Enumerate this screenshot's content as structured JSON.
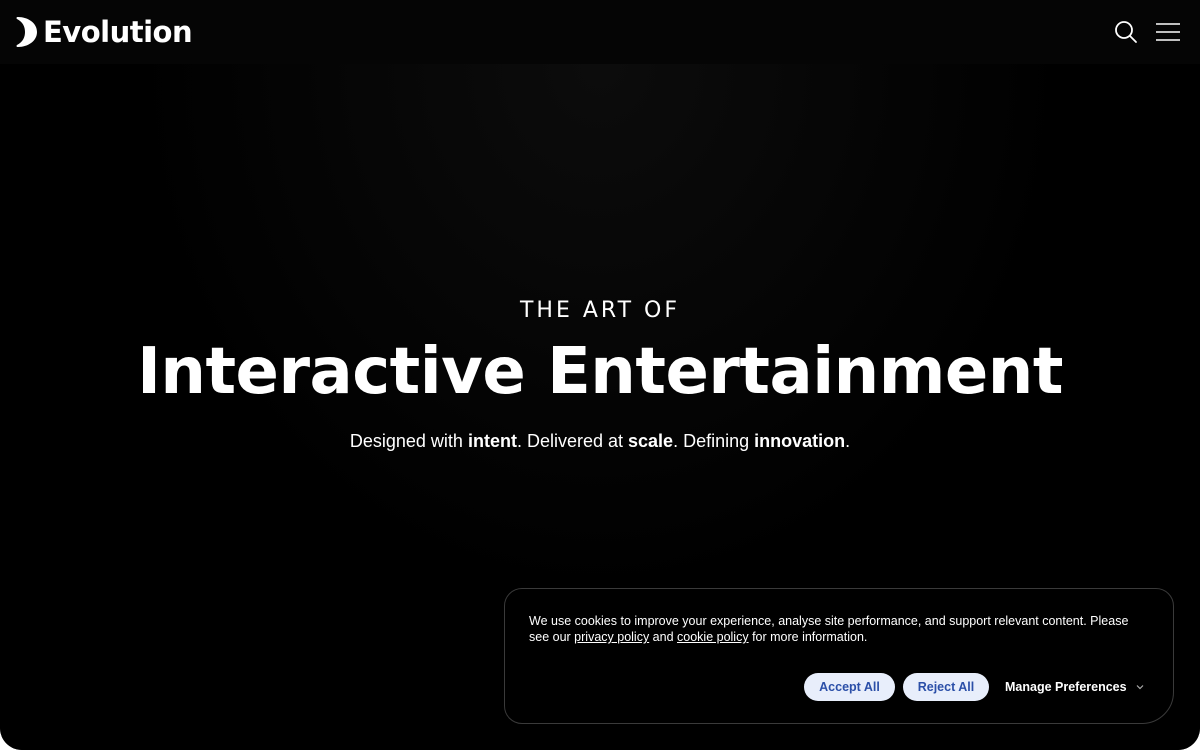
{
  "header": {
    "logo_text": "Evolution",
    "logo_icon": "evolution-logo-mark",
    "search_icon": "search-icon",
    "menu_icon": "hamburger-menu-icon"
  },
  "hero": {
    "eyebrow": "THE ART OF",
    "headline": "Interactive Entertainment",
    "tagline": {
      "part1": "Designed with ",
      "bold1": "intent",
      "part2": ". Delivered at ",
      "bold2": "scale",
      "part3": ". Defining ",
      "bold3": "innovation",
      "part4": "."
    }
  },
  "cookie_banner": {
    "text_before": "We use cookies to improve your experience, analyse site performance, and support relevant content. Please see our ",
    "privacy_link": "privacy policy",
    "text_middle": " and ",
    "cookie_link": "cookie policy",
    "text_after": " for more information.",
    "accept_label": "Accept All",
    "reject_label": "Reject All",
    "manage_label": "Manage Preferences",
    "manage_icon": "chevron-down-icon"
  },
  "colors": {
    "background": "#000000",
    "text": "#ffffff",
    "button_bg": "#e8eefb",
    "button_text": "#2b4fa8",
    "banner_border": "#3a3a3a"
  }
}
